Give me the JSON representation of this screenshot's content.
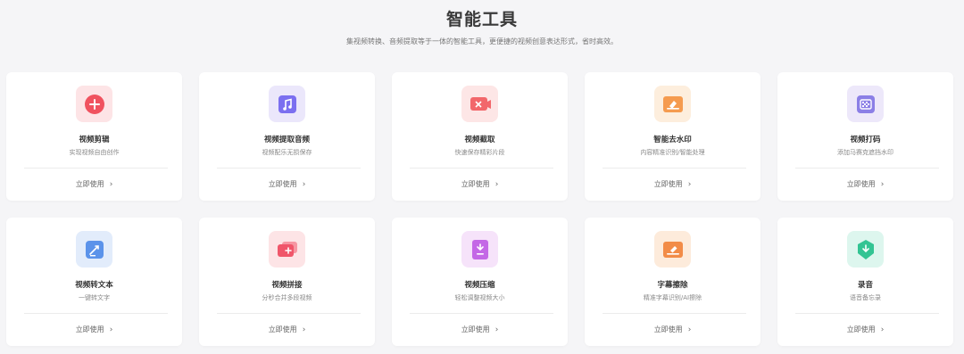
{
  "header": {
    "title": "智能工具",
    "subtitle": "集视频转换、音频提取等于一体的智能工具，更便捷的视频创意表达形式，省时高效。"
  },
  "action_label": "立即使用",
  "action_chevron": "›",
  "tools": [
    {
      "title": "视频剪辑",
      "desc": "实现视频自由创作",
      "icon": "video-edit-icon",
      "bg": "#fde4e6",
      "fg": "#f0525f"
    },
    {
      "title": "视频提取音频",
      "desc": "视频配乐无损保存",
      "icon": "audio-extract-icon",
      "bg": "#ebe7fb",
      "fg": "#7b6ff0"
    },
    {
      "title": "视频截取",
      "desc": "快速保存精彩片段",
      "icon": "video-clip-icon",
      "bg": "#fde6e6",
      "fg": "#f2676b"
    },
    {
      "title": "智能去水印",
      "desc": "内容精准识别/智能处理",
      "icon": "watermark-remove-icon",
      "bg": "#fdeedd",
      "fg": "#f59b4f"
    },
    {
      "title": "视频打码",
      "desc": "添加马赛克遮挡水印",
      "icon": "mosaic-icon",
      "bg": "#ede8fa",
      "fg": "#8b7fe6"
    },
    {
      "title": "视频转文本",
      "desc": "一键转文字",
      "icon": "video-to-text-icon",
      "bg": "#e2ecfb",
      "fg": "#5b93ea"
    },
    {
      "title": "视频拼接",
      "desc": "分秒合并多段视频",
      "icon": "video-merge-icon",
      "bg": "#fde4e6",
      "fg": "#f0566a"
    },
    {
      "title": "视频压缩",
      "desc": "轻松调整视频大小",
      "icon": "video-compress-icon",
      "bg": "#f6e3fa",
      "fg": "#c468e6"
    },
    {
      "title": "字幕擦除",
      "desc": "精准字幕识别/AI擦除",
      "icon": "subtitle-erase-icon",
      "bg": "#fdebdb",
      "fg": "#f28c48"
    },
    {
      "title": "录音",
      "desc": "语音备忘录",
      "icon": "record-icon",
      "bg": "#ddf6ee",
      "fg": "#33c493"
    }
  ]
}
